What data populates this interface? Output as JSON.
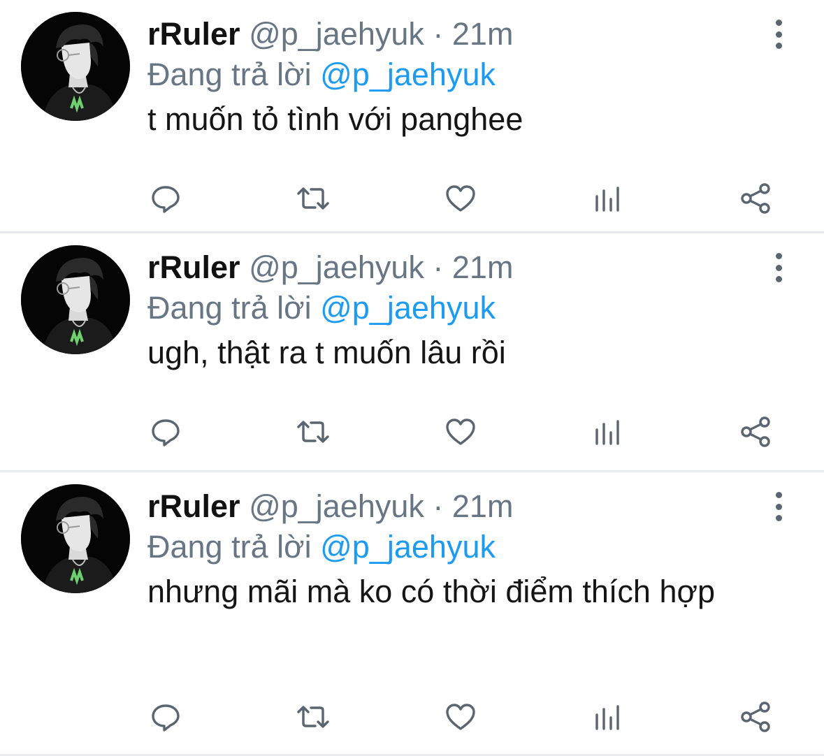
{
  "tweets": [
    {
      "display_name": "rRuler",
      "handle": "@p_jaehyuk",
      "time": "· 21m",
      "reply_prefix": "Đang trả lời",
      "reply_to": "@p_jaehyuk",
      "text": "t muốn tỏ tình với panghee"
    },
    {
      "display_name": "rRuler",
      "handle": "@p_jaehyuk",
      "time": "· 21m",
      "reply_prefix": "Đang trả lời",
      "reply_to": "@p_jaehyuk",
      "text": "ugh, thật ra t muốn lâu rồi"
    },
    {
      "display_name": "rRuler",
      "handle": "@p_jaehyuk",
      "time": "· 21m",
      "reply_prefix": "Đang trả lời",
      "reply_to": "@p_jaehyuk",
      "text": "nhưng mãi mà ko có thời điểm thích hợp"
    }
  ],
  "icons": {
    "reply": "speech-bubble-icon",
    "retweet": "retweet-icon",
    "like": "heart-icon",
    "stats": "bar-chart-icon",
    "share": "share-icon",
    "more": "vertical-dots-icon"
  },
  "colors": {
    "name": "#111111",
    "meta": "#687684",
    "mention": "#1d9bf0",
    "icon": "#5b6570",
    "divider": "#e9ecef"
  }
}
